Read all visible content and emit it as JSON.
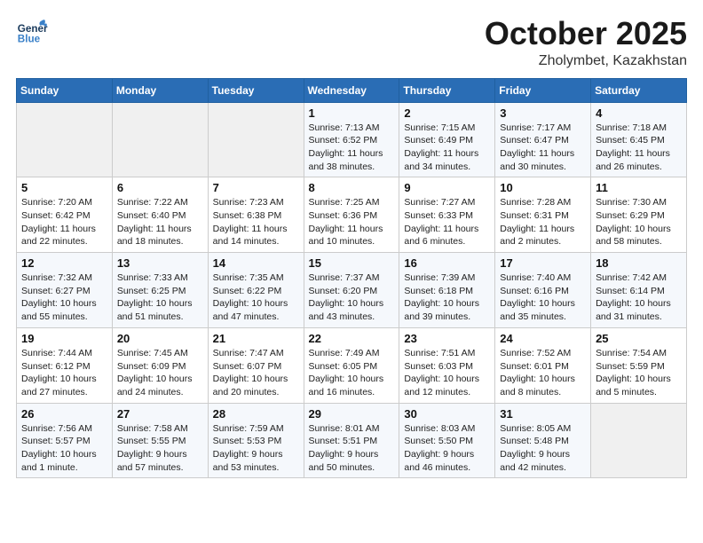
{
  "header": {
    "logo_general": "General",
    "logo_blue": "Blue",
    "month": "October 2025",
    "location": "Zholymbet, Kazakhstan"
  },
  "days_of_week": [
    "Sunday",
    "Monday",
    "Tuesday",
    "Wednesday",
    "Thursday",
    "Friday",
    "Saturday"
  ],
  "weeks": [
    [
      {
        "day": "",
        "info": ""
      },
      {
        "day": "",
        "info": ""
      },
      {
        "day": "",
        "info": ""
      },
      {
        "day": "1",
        "info": "Sunrise: 7:13 AM\nSunset: 6:52 PM\nDaylight: 11 hours\nand 38 minutes."
      },
      {
        "day": "2",
        "info": "Sunrise: 7:15 AM\nSunset: 6:49 PM\nDaylight: 11 hours\nand 34 minutes."
      },
      {
        "day": "3",
        "info": "Sunrise: 7:17 AM\nSunset: 6:47 PM\nDaylight: 11 hours\nand 30 minutes."
      },
      {
        "day": "4",
        "info": "Sunrise: 7:18 AM\nSunset: 6:45 PM\nDaylight: 11 hours\nand 26 minutes."
      }
    ],
    [
      {
        "day": "5",
        "info": "Sunrise: 7:20 AM\nSunset: 6:42 PM\nDaylight: 11 hours\nand 22 minutes."
      },
      {
        "day": "6",
        "info": "Sunrise: 7:22 AM\nSunset: 6:40 PM\nDaylight: 11 hours\nand 18 minutes."
      },
      {
        "day": "7",
        "info": "Sunrise: 7:23 AM\nSunset: 6:38 PM\nDaylight: 11 hours\nand 14 minutes."
      },
      {
        "day": "8",
        "info": "Sunrise: 7:25 AM\nSunset: 6:36 PM\nDaylight: 11 hours\nand 10 minutes."
      },
      {
        "day": "9",
        "info": "Sunrise: 7:27 AM\nSunset: 6:33 PM\nDaylight: 11 hours\nand 6 minutes."
      },
      {
        "day": "10",
        "info": "Sunrise: 7:28 AM\nSunset: 6:31 PM\nDaylight: 11 hours\nand 2 minutes."
      },
      {
        "day": "11",
        "info": "Sunrise: 7:30 AM\nSunset: 6:29 PM\nDaylight: 10 hours\nand 58 minutes."
      }
    ],
    [
      {
        "day": "12",
        "info": "Sunrise: 7:32 AM\nSunset: 6:27 PM\nDaylight: 10 hours\nand 55 minutes."
      },
      {
        "day": "13",
        "info": "Sunrise: 7:33 AM\nSunset: 6:25 PM\nDaylight: 10 hours\nand 51 minutes."
      },
      {
        "day": "14",
        "info": "Sunrise: 7:35 AM\nSunset: 6:22 PM\nDaylight: 10 hours\nand 47 minutes."
      },
      {
        "day": "15",
        "info": "Sunrise: 7:37 AM\nSunset: 6:20 PM\nDaylight: 10 hours\nand 43 minutes."
      },
      {
        "day": "16",
        "info": "Sunrise: 7:39 AM\nSunset: 6:18 PM\nDaylight: 10 hours\nand 39 minutes."
      },
      {
        "day": "17",
        "info": "Sunrise: 7:40 AM\nSunset: 6:16 PM\nDaylight: 10 hours\nand 35 minutes."
      },
      {
        "day": "18",
        "info": "Sunrise: 7:42 AM\nSunset: 6:14 PM\nDaylight: 10 hours\nand 31 minutes."
      }
    ],
    [
      {
        "day": "19",
        "info": "Sunrise: 7:44 AM\nSunset: 6:12 PM\nDaylight: 10 hours\nand 27 minutes."
      },
      {
        "day": "20",
        "info": "Sunrise: 7:45 AM\nSunset: 6:09 PM\nDaylight: 10 hours\nand 24 minutes."
      },
      {
        "day": "21",
        "info": "Sunrise: 7:47 AM\nSunset: 6:07 PM\nDaylight: 10 hours\nand 20 minutes."
      },
      {
        "day": "22",
        "info": "Sunrise: 7:49 AM\nSunset: 6:05 PM\nDaylight: 10 hours\nand 16 minutes."
      },
      {
        "day": "23",
        "info": "Sunrise: 7:51 AM\nSunset: 6:03 PM\nDaylight: 10 hours\nand 12 minutes."
      },
      {
        "day": "24",
        "info": "Sunrise: 7:52 AM\nSunset: 6:01 PM\nDaylight: 10 hours\nand 8 minutes."
      },
      {
        "day": "25",
        "info": "Sunrise: 7:54 AM\nSunset: 5:59 PM\nDaylight: 10 hours\nand 5 minutes."
      }
    ],
    [
      {
        "day": "26",
        "info": "Sunrise: 7:56 AM\nSunset: 5:57 PM\nDaylight: 10 hours\nand 1 minute."
      },
      {
        "day": "27",
        "info": "Sunrise: 7:58 AM\nSunset: 5:55 PM\nDaylight: 9 hours\nand 57 minutes."
      },
      {
        "day": "28",
        "info": "Sunrise: 7:59 AM\nSunset: 5:53 PM\nDaylight: 9 hours\nand 53 minutes."
      },
      {
        "day": "29",
        "info": "Sunrise: 8:01 AM\nSunset: 5:51 PM\nDaylight: 9 hours\nand 50 minutes."
      },
      {
        "day": "30",
        "info": "Sunrise: 8:03 AM\nSunset: 5:50 PM\nDaylight: 9 hours\nand 46 minutes."
      },
      {
        "day": "31",
        "info": "Sunrise: 8:05 AM\nSunset: 5:48 PM\nDaylight: 9 hours\nand 42 minutes."
      },
      {
        "day": "",
        "info": ""
      }
    ]
  ]
}
